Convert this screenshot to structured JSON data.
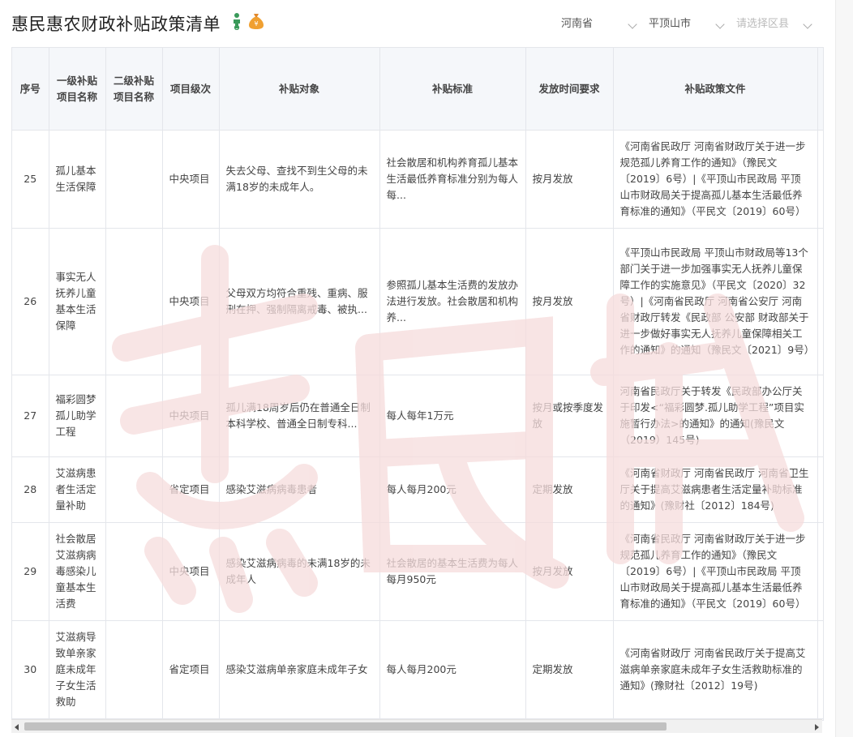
{
  "page": {
    "title": "惠民惠农财政补贴政策清单",
    "icons": [
      "people-icon",
      "money-bag-icon"
    ]
  },
  "filters": {
    "province": "河南省",
    "city": "平顶山市",
    "county_placeholder": "请选择区县"
  },
  "table": {
    "headers": [
      "序号",
      "一级补贴项目名称",
      "二级补贴项目名称",
      "项目级次",
      "补贴对象",
      "补贴标准",
      "发放时间要求",
      "补贴政策文件"
    ],
    "rows": [
      {
        "no": "25",
        "level1": "孤儿基本生活保障",
        "level2": "",
        "grade": "中央项目",
        "target": "失去父母、查找不到生父母的未满18岁的未成年人。",
        "standard": "社会散居和机构养育孤儿基本生活最低养育标准分别为每人每...",
        "timing": "按月发放",
        "policy": "《河南省民政厅 河南省财政厅关于进一步规范孤儿养育工作的通知》（豫民文〔2019〕6号）|《平顶山市民政局 平顶山市财政局关于提高孤儿基本生活最低养育标准的通知》（平民文〔2019〕60号）"
      },
      {
        "no": "26",
        "level1": "事实无人抚养儿童基本生活保障",
        "level2": "",
        "grade": "中央项目",
        "target": "父母双方均符合重残、重病、服刑在押、强制隔离戒毒、被执...",
        "standard": "参照孤儿基本生活费的发放办法进行发放。社会散居和机构养...",
        "timing": "按月发放",
        "policy": "《平顶山市民政局 平顶山市财政局等13个部门关于进一步加强事实无人抚养儿童保障工作的实施意见》（平民文〔2020〕32号）|《河南省民政厅 河南省公安厅 河南省财政厅转发《民政部 公安部 财政部关于进一步做好事实无人抚养儿童保障相关工作的通知》的通知（豫民文〔2021〕9号）"
      },
      {
        "no": "27",
        "level1": "福彩圆梦孤儿助学工程",
        "level2": "",
        "grade": "中央项目",
        "target": "孤儿满18周岁后仍在普通全日制本科学校、普通全日制专科...",
        "standard": "每人每年1万元",
        "timing": "按月或按季度发放",
        "policy": "河南省民政厅关于转发《民政部办公厅关于印发<“福彩圆梦.孤儿助学工程”项目实施暂行办法>的通知》的通知(豫民文（2019）145号)"
      },
      {
        "no": "28",
        "level1": "艾滋病患者生活定量补助",
        "level2": "",
        "grade": "省定项目",
        "target": "感染艾滋病病毒患者",
        "standard": "每人每月200元",
        "timing": "定期发放",
        "policy": "《河南省财政厅 河南省民政厅 河南省卫生厅关于提高艾滋病患者生活定量补助标准的通知》(豫财社〔2012〕184号)"
      },
      {
        "no": "29",
        "level1": "社会散居艾滋病病毒感染儿童基本生活费",
        "level2": "",
        "grade": "中央项目",
        "target": "感染艾滋病病毒的未满18岁的未成年人",
        "standard": "社会散居的基本生活费为每人每月950元",
        "timing": "按月发放",
        "policy": "《河南省民政厅 河南省财政厅关于进一步规范孤儿养育工作的通知》（豫民文〔2019〕6号）|《平顶山市民政局 平顶山市财政局关于提高孤儿基本生活最低养育标准的通知》（平民文〔2019〕60号）"
      },
      {
        "no": "30",
        "level1": "艾滋病导致单亲家庭未成年子女生活救助",
        "level2": "",
        "grade": "省定项目",
        "target": "感染艾滋病单亲家庭未成年子女",
        "standard": "每人每月200元",
        "timing": "定期发放",
        "policy": "《河南省财政厅 河南省民政厅关于提高艾滋病单亲家庭未成年子女生活救助标准的通知》(豫财社〔2012〕19号)"
      }
    ]
  },
  "colors": {
    "header_bg": "#f5f7fa",
    "border": "#e4e6eb",
    "watermark": "#f6d9d9"
  }
}
